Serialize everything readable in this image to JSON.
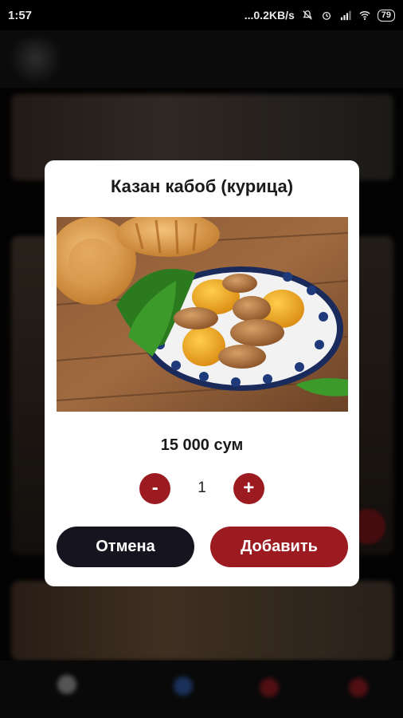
{
  "status_bar": {
    "time": "1:57",
    "net_speed": "...0.2KB/s",
    "battery": "79"
  },
  "dialog": {
    "title": "Казан кабоб (курица)",
    "price": "15 000 сум",
    "quantity": "1",
    "minus_label": "-",
    "plus_label": "+",
    "cancel_label": "Отмена",
    "add_label": "Добавить"
  },
  "colors": {
    "accent": "#9b1b21",
    "cancel_bg": "#15141f",
    "dialog_bg": "#ffffff"
  }
}
